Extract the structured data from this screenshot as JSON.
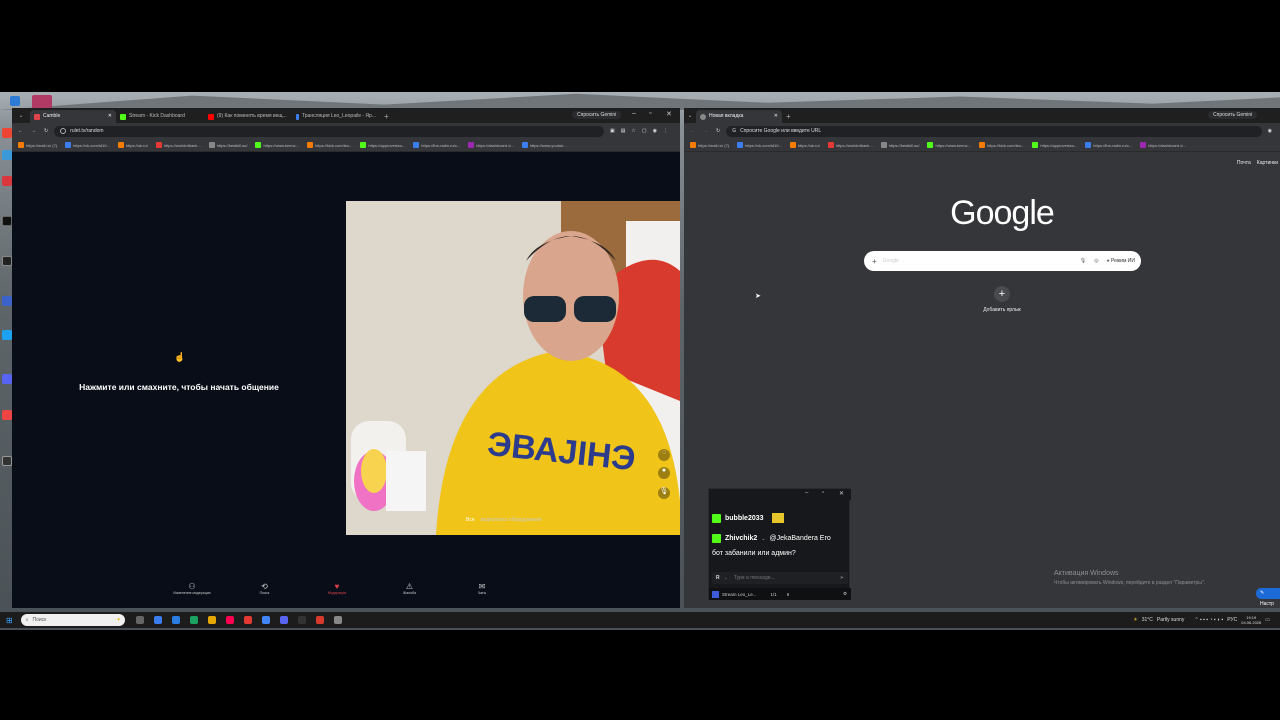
{
  "left_browser": {
    "tabs": [
      {
        "label": "Camble",
        "fav_color": "#e0434b"
      },
      {
        "label": "Stream - Kick Dashboard",
        "fav_color": "#53fc18"
      },
      {
        "label": "(9) Как поменять время вещ...",
        "fav_color": "#ff0000"
      },
      {
        "label": "Трансляция Leo_Leopaile - Яр...",
        "fav_color": "#3b7ded"
      }
    ],
    "new_tab": "+",
    "gemini": "Спросить Gemini",
    "url": "rulet.tv/random",
    "bookmarks": [
      "https://mail.ru/ (7)",
      "https://vk.com/id10...",
      "https://ok.ru/",
      "https://worldofbank...",
      "https://bestkill.su/",
      "https://www.keeuc...",
      "https://kick.com/leo...",
      "https://approveissu...",
      "https://the-radio.ru/c...",
      "https://dashboard.d...",
      "https://www.youtub..."
    ],
    "prompt": "Нажмите или смахните, чтобы начать общение",
    "cam_caption_left": "Все",
    "cam_caption_right": "видеопоиск оборудования",
    "toolbar": [
      {
        "label": "Изменение модерации"
      },
      {
        "label": "Поиск"
      },
      {
        "label": "Модерация"
      },
      {
        "label": "Жалоба"
      },
      {
        "label": "Чаты"
      }
    ]
  },
  "right_browser": {
    "tab": "Новая вкладка",
    "new_tab": "+",
    "gemini": "Спросить Gemini",
    "url_placeholder": "Спросите Google или введите URL",
    "bookmarks": [
      "https://mail.ru/ (7)",
      "https://vk.com/id10...",
      "https://ok.ru/",
      "https://worldofbank...",
      "https://bestkill.su/",
      "https://www.keeuc...",
      "https://kick.com/leo...",
      "https://approveissu...",
      "https://the-radio.ru/c...",
      "https://dashboard.d..."
    ],
    "top_links": [
      "Почта",
      "Картинки"
    ],
    "logo": "Google",
    "search_placeholder": "Google",
    "ai_mode": "Режим ИИ",
    "add_shortcut": "Добавить ярлык",
    "activation_title": "Активация Windows",
    "activation_sub": "Чтобы активировать Windows, перейдите в раздел \"Параметры\".",
    "customize": "Настр"
  },
  "chat_popup": {
    "messages": [
      {
        "user": "bubble2033",
        "text": "",
        "badge_color": "#53fc18"
      },
      {
        "user": "Zhivchik2",
        "text": "@JekaBandera Его",
        "badge_color": "#53fc18"
      },
      {
        "user": "",
        "text": "бот забанили или админ?",
        "badge_color": ""
      }
    ],
    "input_placeholder": "Type a message...",
    "stream_label": "Stream Leo_Le...",
    "counters": [
      "1/1",
      "6"
    ]
  },
  "taskbar": {
    "search_placeholder": "Поиск",
    "weather": "31°C",
    "weather_desc": "Partly sunny",
    "lang": "РУС",
    "time": "19:19",
    "date": "04.06.2026"
  },
  "colors": {
    "kick_green": "#53fc18",
    "google_search_bg": "#ffffff",
    "dark_bg": "#080d18"
  }
}
